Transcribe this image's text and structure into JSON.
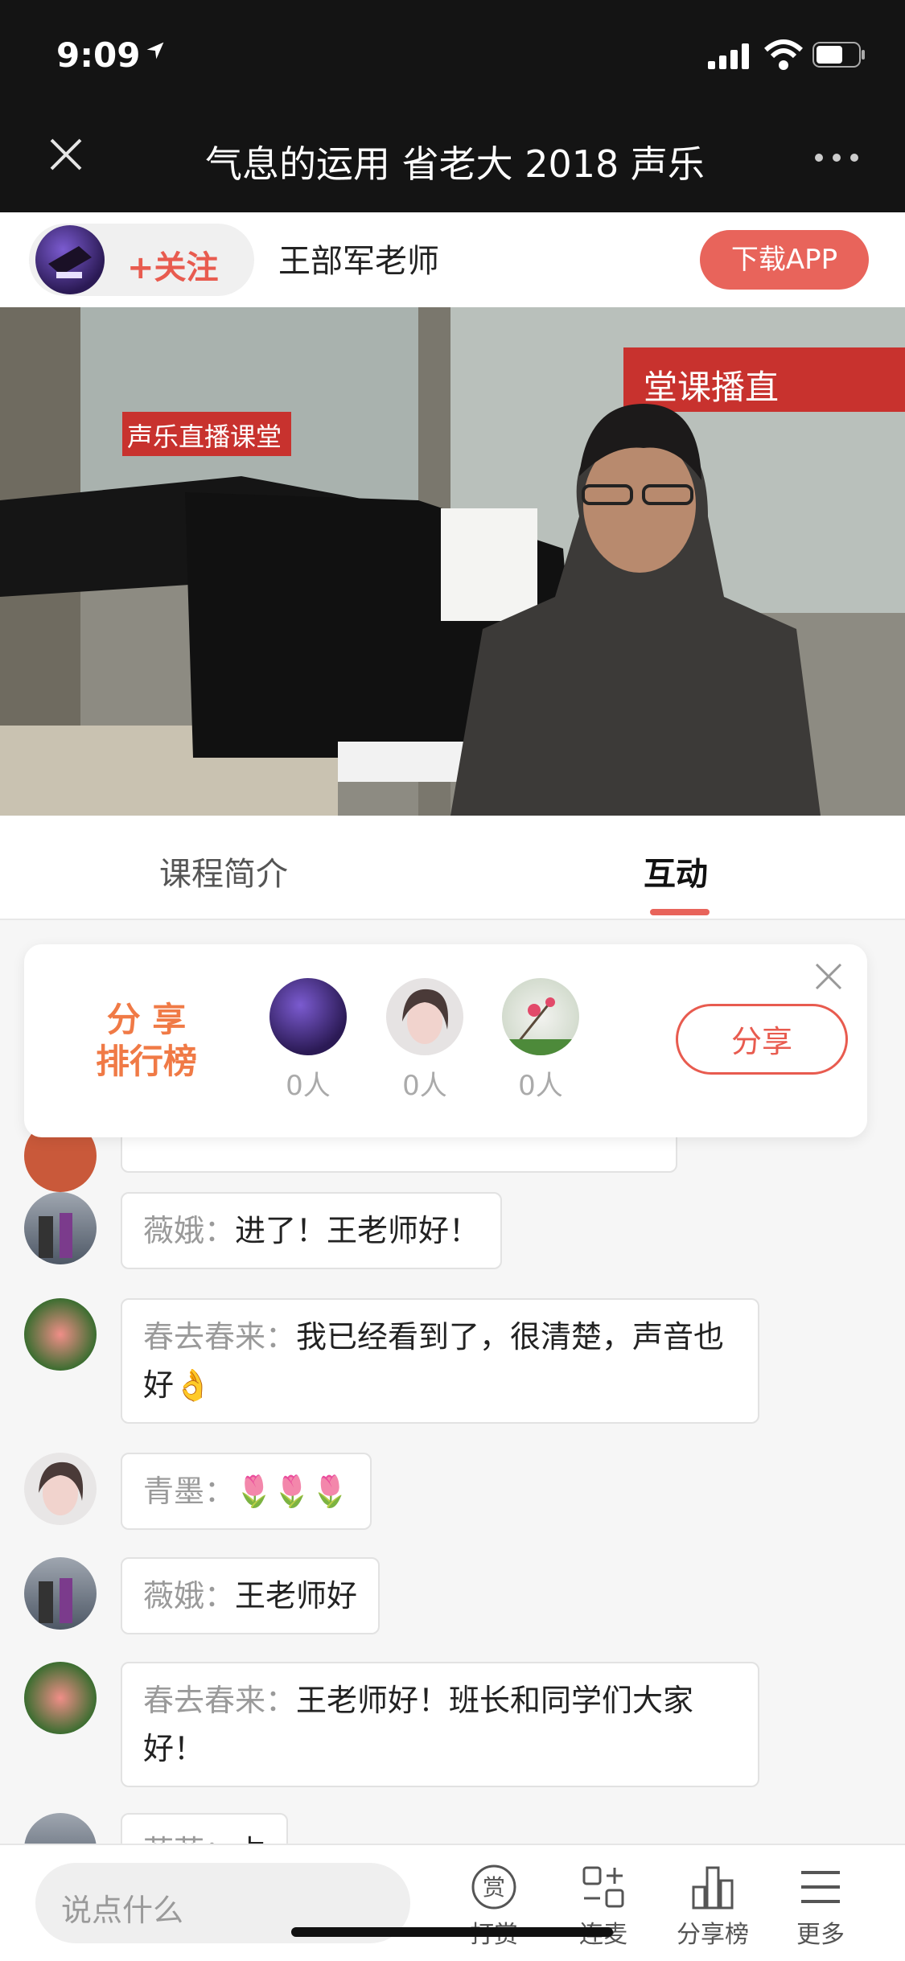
{
  "status_bar": {
    "time": "9:09"
  },
  "nav": {
    "title": "气息的运用 省老大 2018 声乐"
  },
  "teacher": {
    "follow": "+关注",
    "name": "王部军老师",
    "download": "下载APP"
  },
  "video": {
    "banner_left": "声乐直播课堂",
    "banner_right": "堂课播直"
  },
  "tabs": [
    {
      "label": "课程简介"
    },
    {
      "label": "互动"
    }
  ],
  "share_rank": {
    "title_line1": "分  享",
    "title_line2": "排行榜",
    "entries": [
      {
        "count": "0人"
      },
      {
        "count": "0人"
      },
      {
        "count": "0人"
      }
    ],
    "share_button": "分享"
  },
  "messages": [
    {
      "name": "薇娥：",
      "text": "进了！王老师好！"
    },
    {
      "name": "春去春来：",
      "text": "我已经看到了，很清楚，声音也好👌"
    },
    {
      "name": "青墨：",
      "text": "🌷🌷🌷"
    },
    {
      "name": "薇娥：",
      "text": "王老师好"
    },
    {
      "name": "春去春来：",
      "text": "王老师好！班长和同学们大家好！"
    },
    {
      "name": "菲菲：",
      "text": "占"
    }
  ],
  "bottom_bar": {
    "placeholder": "说点什么",
    "tools": [
      {
        "label": "打赏",
        "icon": "reward-icon"
      },
      {
        "label": "连麦",
        "icon": "connect-mic-icon"
      },
      {
        "label": "分享榜",
        "icon": "share-rank-icon"
      },
      {
        "label": "更多",
        "icon": "menu-icon"
      }
    ]
  }
}
